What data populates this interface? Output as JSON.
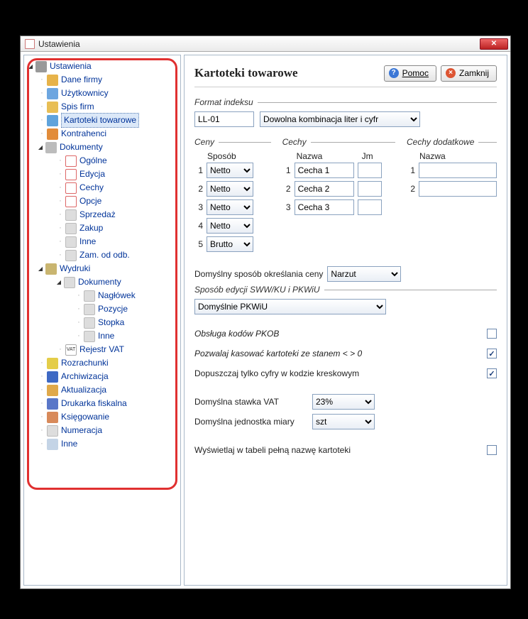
{
  "window": {
    "title": "Ustawienia",
    "close": "✕"
  },
  "header": {
    "title": "Kartoteki towarowe",
    "help_btn": "Pomoc",
    "close_btn": "Zamknij"
  },
  "tree": {
    "root": "Ustawienia",
    "items": [
      "Dane firmy",
      "Użytkownicy",
      "Spis firm",
      "Kartoteki towarowe",
      "Kontrahenci"
    ],
    "dokumenty": {
      "label": "Dokumenty",
      "children": [
        "Ogólne",
        "Edycja",
        "Cechy",
        "Opcje",
        "Sprzedaż",
        "Zakup",
        "Inne",
        "Zam. od odb."
      ]
    },
    "wydruki": {
      "label": "Wydruki",
      "dokumenty": {
        "label": "Dokumenty",
        "children": [
          "Nagłówek",
          "Pozycje",
          "Stopka",
          "Inne"
        ]
      },
      "rejestr_vat": "Rejestr VAT"
    },
    "rest": [
      "Rozrachunki",
      "Archiwizacja",
      "Aktualizacja",
      "Drukarka fiskalna",
      "Księgowanie",
      "Numeracja",
      "Inne"
    ]
  },
  "form": {
    "index_legend": "Format indeksu",
    "index_value": "LL-01",
    "index_mode": "Dowolna kombinacja liter i cyfr",
    "ceny_legend": "Ceny",
    "ceny_sub": "Sposób",
    "ceny_rows": [
      {
        "n": "1",
        "v": "Netto"
      },
      {
        "n": "2",
        "v": "Netto"
      },
      {
        "n": "3",
        "v": "Netto"
      },
      {
        "n": "4",
        "v": "Netto"
      },
      {
        "n": "5",
        "v": "Brutto"
      }
    ],
    "cechy_legend": "Cechy",
    "cechy_name": "Nazwa",
    "cechy_jm": "Jm",
    "cechy_rows": [
      {
        "n": "1",
        "name": "Cecha 1",
        "jm": ""
      },
      {
        "n": "2",
        "name": "Cecha 2",
        "jm": ""
      },
      {
        "n": "3",
        "name": "Cecha 3",
        "jm": ""
      }
    ],
    "extra_legend": "Cechy dodatkowe",
    "extra_name": "Nazwa",
    "extra_rows": [
      {
        "n": "1",
        "name": ""
      },
      {
        "n": "2",
        "name": ""
      }
    ],
    "default_price_label": "Domyślny sposób określania ceny",
    "default_price_value": "Narzut",
    "sww_legend": "Sposób edycji SWW/KU i PKWiU",
    "sww_value": "Domyślnie PKWiU",
    "pkob_label": "Obsługa kodów PKOB",
    "pkob_checked": false,
    "delete_stock_label": "Pozwalaj kasować kartoteki ze stanem < > 0",
    "delete_stock_checked": true,
    "digits_barcode_label": "Dopuszczaj tylko cyfry w kodzie kreskowym",
    "digits_barcode_checked": true,
    "vat_label": "Domyślna stawka VAT",
    "vat_value": "23%",
    "unit_label": "Domyślna jednostka miary",
    "unit_value": "szt",
    "fullname_label": "Wyświetlaj w tabeli pełną nazwę kartoteki",
    "fullname_checked": false
  }
}
